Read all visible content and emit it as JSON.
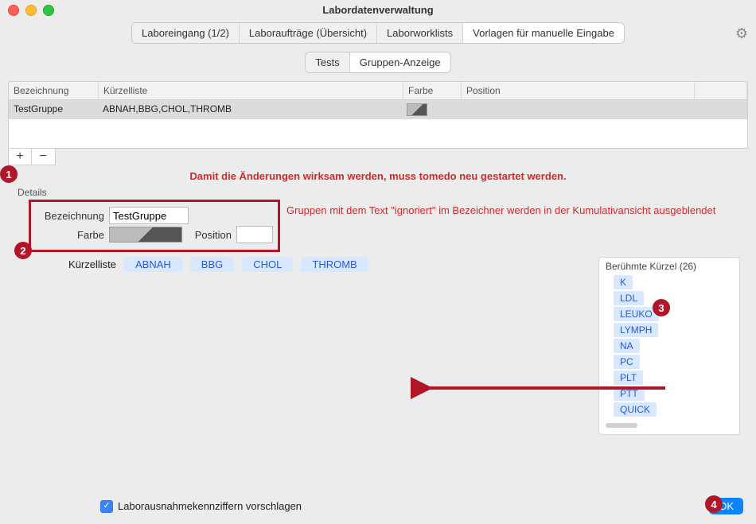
{
  "window": {
    "title": "Labordatenverwaltung"
  },
  "tabs_primary": {
    "items": [
      "Laboreingang (1/2)",
      "Laboraufträge (Übersicht)",
      "Laborworklists",
      "Vorlagen für manuelle Eingabe"
    ],
    "selected_index": 3
  },
  "tabs_secondary": {
    "items": [
      "Tests",
      "Gruppen-Anzeige"
    ],
    "selected_index": 1
  },
  "gear_icon": "⚙",
  "table": {
    "columns": [
      "Bezeichnung",
      "Kürzelliste",
      "Farbe",
      "Position"
    ],
    "row": {
      "bezeichnung": "TestGruppe",
      "kuerzelliste": "ABNAH,BBG,CHOL,THROMB",
      "farbe": "gradient",
      "position": ""
    }
  },
  "buttons": {
    "add": "+",
    "remove": "−"
  },
  "warning_text": "Damit die Änderungen wirksam werden, muss tomedo neu gestartet werden.",
  "details": {
    "label": "Details",
    "bezeichnung_label": "Bezeichnung",
    "bezeichnung_value": "TestGruppe",
    "farbe_label": "Farbe",
    "position_label": "Position",
    "position_value": "",
    "hint": "Gruppen mit dem Text \"ignoriert\" im Bezeichner werden in der Kumulativansicht ausgeblendet",
    "kuerzelliste_label": "Kürzelliste",
    "tokens": [
      "ABNAH",
      "BBG",
      "CHOL",
      "THROMB"
    ]
  },
  "famous": {
    "title": "Berühmte Kürzel (26)",
    "items": [
      "K",
      "LDL",
      "LEUKO",
      "LYMPH",
      "NA",
      "PC",
      "PLT",
      "PTT",
      "QUICK"
    ]
  },
  "bottom": {
    "checkbox_label": "Laborausnahmekennziffern vorschlagen",
    "checkbox_checked": true,
    "ok_label": "OK"
  },
  "callouts": {
    "c1": "1",
    "c2": "2",
    "c3": "3",
    "c4": "4"
  }
}
